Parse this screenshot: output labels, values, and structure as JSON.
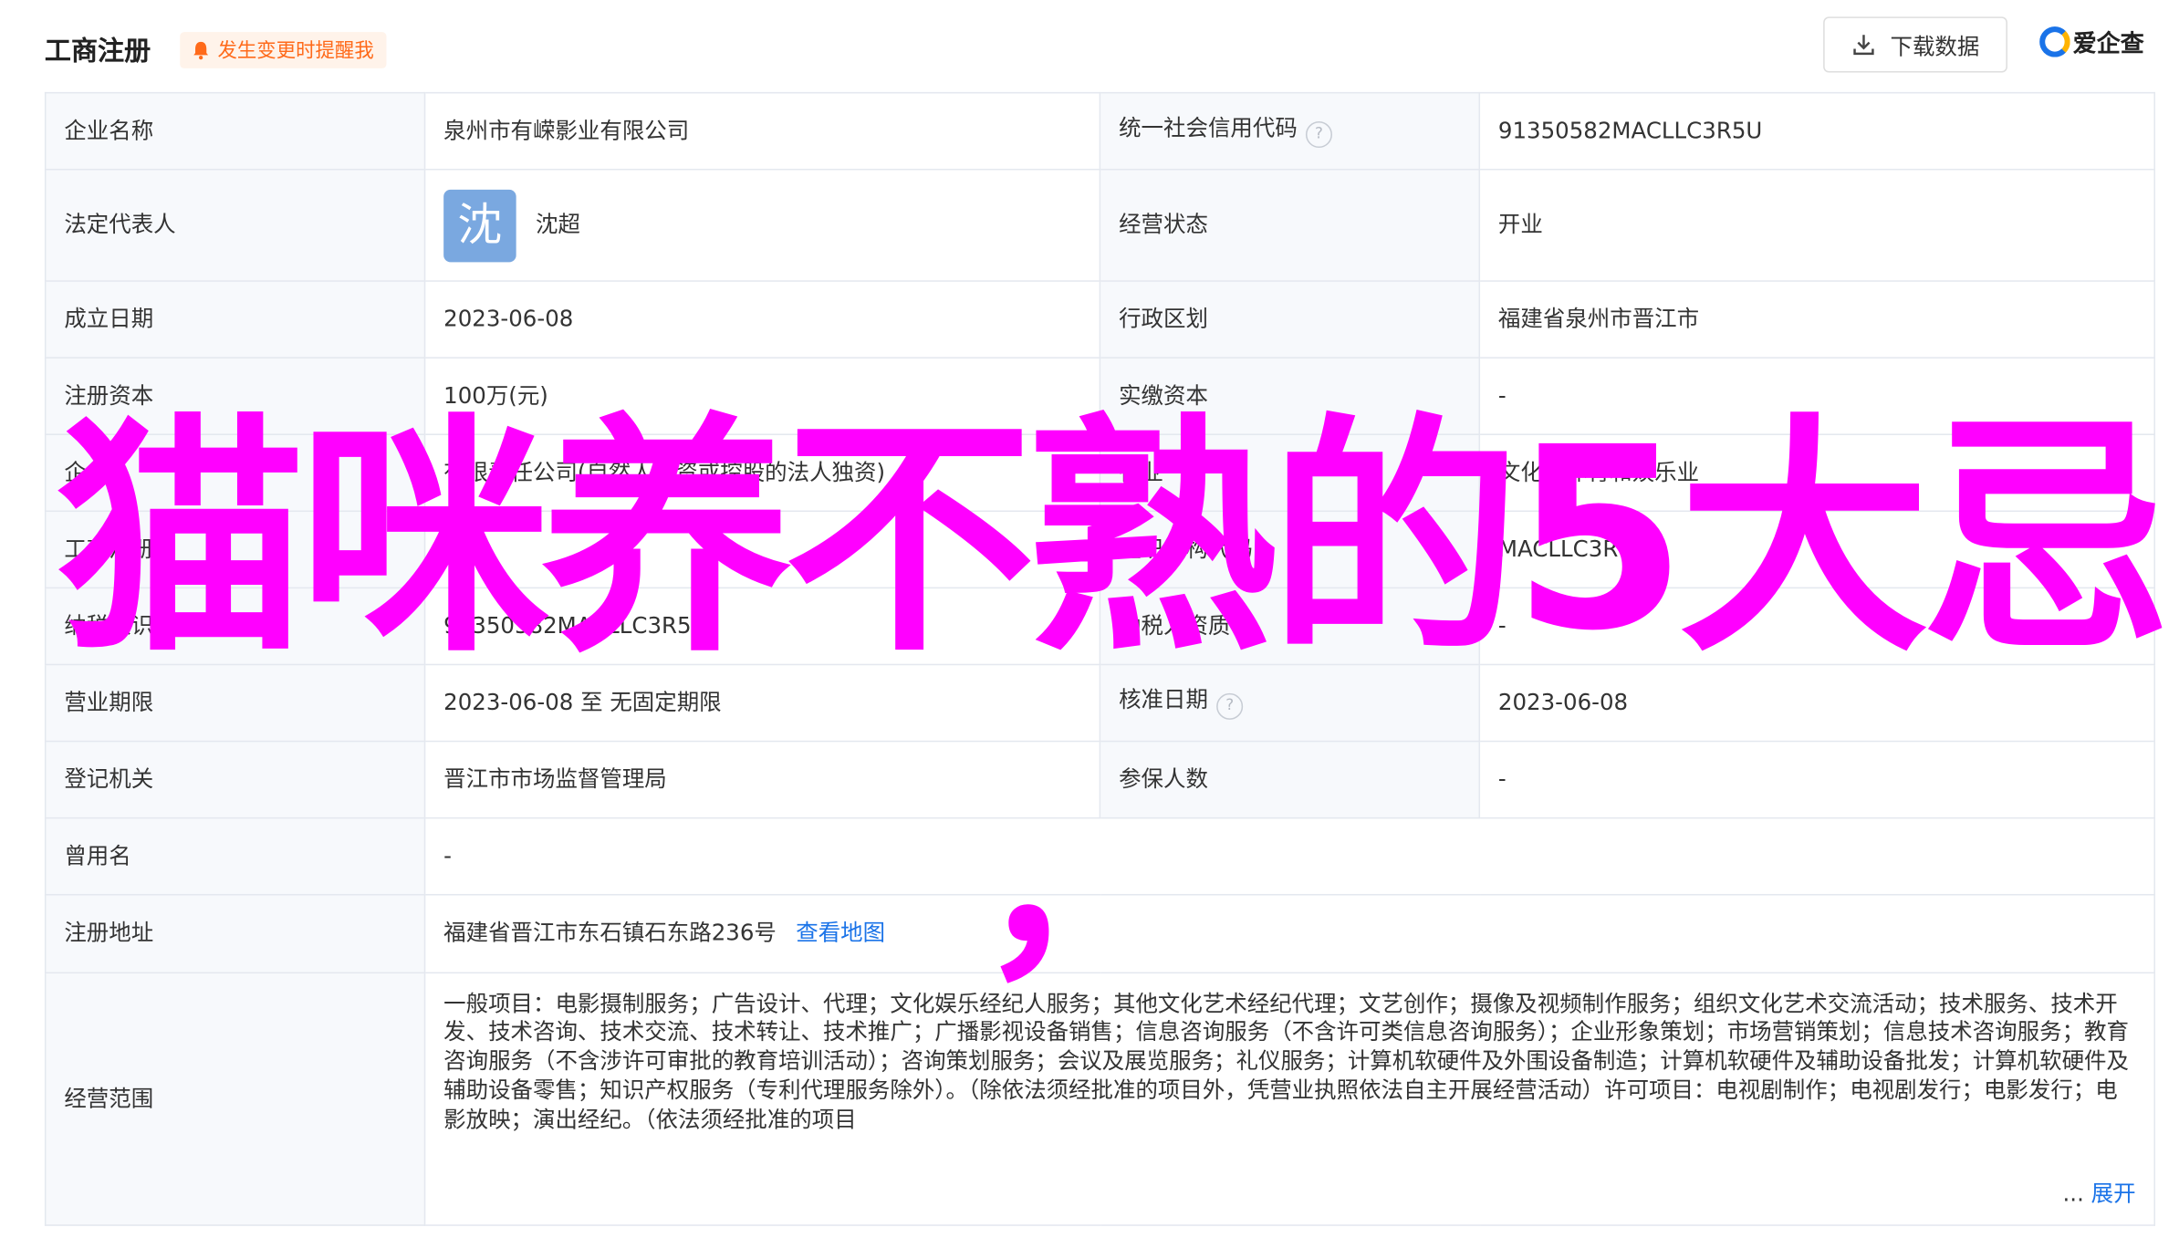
{
  "header": {
    "title": "工商注册",
    "alert": "发生变更时提醒我",
    "download_label": "下载数据",
    "brand": "爱企查"
  },
  "rows": {
    "company_name": {
      "label": "企业名称",
      "value": "泉州市有嵘影业有限公司"
    },
    "credit_code": {
      "label": "统一社会信用代码",
      "value": "91350582MACLLC3R5U"
    },
    "legal_rep": {
      "label": "法定代表人",
      "avatar": "沈",
      "value": "沈超"
    },
    "status": {
      "label": "经营状态",
      "value": "开业"
    },
    "found_date": {
      "label": "成立日期",
      "value": "2023-06-08"
    },
    "region": {
      "label": "行政区划",
      "value": "福建省泉州市晋江市"
    },
    "reg_capital": {
      "label": "注册资本",
      "value": "100万(元)"
    },
    "paid_capital": {
      "label": "实缴资本",
      "value": "-"
    },
    "company_type": {
      "label": "企",
      "value": "有限责任公司(自然人投资或控股的法人独资)"
    },
    "industry": {
      "label": "行业",
      "value": "文化、体育和娱乐业"
    },
    "reg_no": {
      "label": "工商注册号",
      "value": ""
    },
    "org_code": {
      "label": "组织机构代码",
      "value": "MACLLC3R-5"
    },
    "taxpayer_id": {
      "label": "纳税人识别号",
      "value": "91350582MACLLC3R5U"
    },
    "taxpayer_qual": {
      "label": "纳税人资质",
      "value": "-"
    },
    "term": {
      "label": "营业期限",
      "value": "2023-06-08 至 无固定期限"
    },
    "approve_date": {
      "label": "核准日期",
      "value": "2023-06-08"
    },
    "authority": {
      "label": "登记机关",
      "value": "晋江市市场监督管理局"
    },
    "insured": {
      "label": "参保人数",
      "value": "-"
    },
    "former_name": {
      "label": "曾用名",
      "value": "-"
    },
    "address": {
      "label": "注册地址",
      "value": "福建省晋江市东石镇石东路236号",
      "map_link": "查看地图"
    },
    "scope": {
      "label": "经营范围",
      "value": "一般项目：电影摄制服务；广告设计、代理；文化娱乐经纪人服务；其他文化艺术经纪代理；文艺创作；摄像及视频制作服务；组织文化艺术交流活动；技术服务、技术开发、技术咨询、技术交流、技术转让、技术推广；广播影视设备销售；信息咨询服务（不含许可类信息咨询服务）；企业形象策划；市场营销策划；信息技术咨询服务；教育咨询服务（不含涉许可审批的教育培训活动）；咨询策划服务；会议及展览服务；礼仪服务；计算机软硬件及外围设备制造；计算机软硬件及辅助设备批发；计算机软硬件及辅助设备零售；知识产权服务（专利代理服务除外）。（除依法须经批准的项目外，凭营业执照依法自主开展经营活动）许可项目：电视剧制作；电视剧发行；电影发行；电影放映；演出经纪。（依法须经批准的项目",
      "ellipsis": "...",
      "expand": "展开"
    }
  },
  "overlay": {
    "headline": "猫咪养不熟的5大忌",
    "comma": "，",
    "color": "#ff00ff"
  },
  "icons": {
    "alert": "bell-icon",
    "download": "download-icon",
    "help": "question-circle-icon"
  }
}
